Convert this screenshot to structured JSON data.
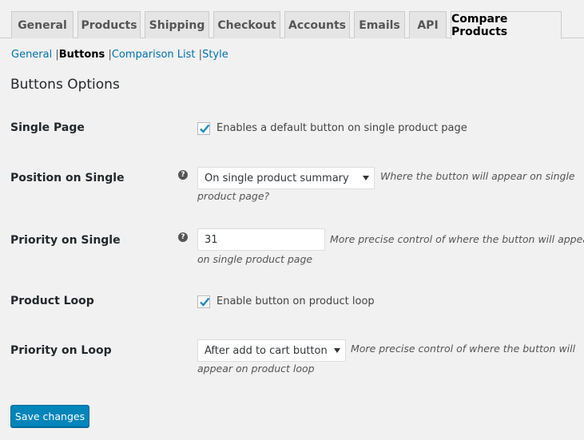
{
  "tabs": [
    {
      "label": "General"
    },
    {
      "label": "Products"
    },
    {
      "label": "Shipping"
    },
    {
      "label": "Checkout"
    },
    {
      "label": "Accounts"
    },
    {
      "label": "Emails"
    },
    {
      "label": "API"
    },
    {
      "label": "Compare Products",
      "active": true
    }
  ],
  "subnav": {
    "general": "General",
    "buttons": "Buttons",
    "comparison_list": "Comparison List",
    "style": "Style",
    "separator": "|"
  },
  "section_title": "Buttons Options",
  "fields": {
    "single_page": {
      "label": "Single Page",
      "checked": true,
      "checkbox_text": "Enables a default button on single product page"
    },
    "position_on_single": {
      "label": "Position on Single",
      "help_icon": "?",
      "selected": "On single product summary",
      "desc_line1": "Where the button will appear on single",
      "desc_line2": "product page?"
    },
    "priority_on_single": {
      "label": "Priority on Single",
      "help_icon": "?",
      "value": "31",
      "desc_line1": "More precise control of where the button will appear",
      "desc_line2": "on single product page"
    },
    "product_loop": {
      "label": "Product Loop",
      "checked": true,
      "checkbox_text": "Enable button on product loop"
    },
    "priority_on_loop": {
      "label": "Priority on Loop",
      "selected": "After add to cart button",
      "desc_line1": "More precise control of where the button will",
      "desc_line2": "appear on product loop"
    }
  },
  "save_button": "Save changes",
  "colors": {
    "accent": "#0085ba",
    "link": "#0073aa",
    "checkmark": "#1e8cbe"
  }
}
